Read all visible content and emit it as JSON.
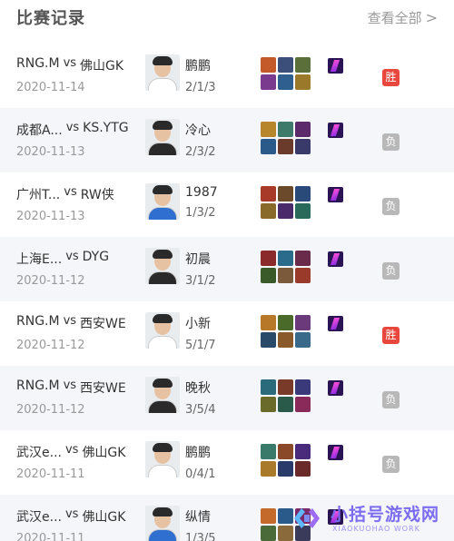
{
  "header": {
    "title": "比赛记录",
    "more_label": "查看全部",
    "more_icon": "chevron-right-icon"
  },
  "colors": {
    "win": "#e8473d",
    "lose": "#b8b8b8",
    "row_alt": "#f4f6fa",
    "accent": "#7c6cf0"
  },
  "matches": [
    {
      "team_a": "RNG.M",
      "vs": "vs",
      "team_b": "佛山GK",
      "date": "2020-11-14",
      "player": "鹏鹏",
      "kda": "2/1/3",
      "result": "胜",
      "outcome": "win",
      "heroes": [
        "#c45a2a",
        "#3b4f7a",
        "#5a6f3a",
        "#7a3b8f",
        "#2f5f8f",
        "#9a7a2a"
      ],
      "jersey": "#ffffff"
    },
    {
      "team_a": "成都A...",
      "vs": "vs",
      "team_b": "KS.YTG",
      "date": "2020-11-13",
      "player": "冷心",
      "kda": "2/3/2",
      "result": "负",
      "outcome": "lose",
      "heroes": [
        "#b8862a",
        "#3d7a6a",
        "#5a2a6a",
        "#2a5a8a",
        "#6a3a2a",
        "#3a3a6a"
      ],
      "jersey": "#2a2a2a"
    },
    {
      "team_a": "广州T...",
      "vs": "vs",
      "team_b": "RW侠",
      "date": "2020-11-13",
      "player": "1987",
      "kda": "1/3/2",
      "result": "负",
      "outcome": "lose",
      "heroes": [
        "#a83a2a",
        "#6a4a2a",
        "#2a4a7a",
        "#8a6a2a",
        "#4a2a6a",
        "#2a6a5a"
      ],
      "jersey": "#2f6fd0"
    },
    {
      "team_a": "上海E...",
      "vs": "vs",
      "team_b": "DYG",
      "date": "2020-11-12",
      "player": "初晨",
      "kda": "3/1/2",
      "result": "负",
      "outcome": "lose",
      "heroes": [
        "#8a2a2a",
        "#2a6a8a",
        "#6a2a4a",
        "#3a5a2a",
        "#7a5a3a",
        "#9a3a2a"
      ],
      "jersey": "#2a2a2a"
    },
    {
      "team_a": "RNG.M",
      "vs": "vs",
      "team_b": "西安WE",
      "date": "2020-11-12",
      "player": "小新",
      "kda": "5/1/7",
      "result": "胜",
      "outcome": "win",
      "heroes": [
        "#b8782a",
        "#4a6a2a",
        "#6a3a7a",
        "#2a4a6a",
        "#8a5a2a",
        "#3a6a8a"
      ],
      "jersey": "#ffffff"
    },
    {
      "team_a": "RNG.M",
      "vs": "vs",
      "team_b": "西安WE",
      "date": "2020-11-12",
      "player": "晚秋",
      "kda": "3/5/4",
      "result": "负",
      "outcome": "lose",
      "heroes": [
        "#2a6a7a",
        "#7a3a2a",
        "#3a3a7a",
        "#6a6a2a",
        "#2a5a4a",
        "#8a2a5a"
      ],
      "jersey": "#2a2a2a"
    },
    {
      "team_a": "武汉e...",
      "vs": "vs",
      "team_b": "佛山GK",
      "date": "2020-11-11",
      "player": "鹏鹏",
      "kda": "0/4/1",
      "result": "负",
      "outcome": "lose",
      "heroes": [
        "#3a7a6a",
        "#8a4a2a",
        "#4a2a7a",
        "#a87a2a",
        "#2a3a6a",
        "#6a2a2a"
      ],
      "jersey": "#ffffff"
    },
    {
      "team_a": "武汉e...",
      "vs": "vs",
      "team_b": "佛山GK",
      "date": "2020-11-11",
      "player": "纵情",
      "kda": "1/3/5",
      "result": "",
      "outcome": "none",
      "heroes": [
        "#c46a2a",
        "#2a5a8a",
        "#7a2a6a",
        "#4a6a3a",
        "#8a6a3a",
        "#3a3a5a"
      ],
      "jersey": "#2f6fd0"
    }
  ],
  "watermark": {
    "text": "小括号游戏网",
    "sub": "XIAOKUOHAO WORK"
  }
}
